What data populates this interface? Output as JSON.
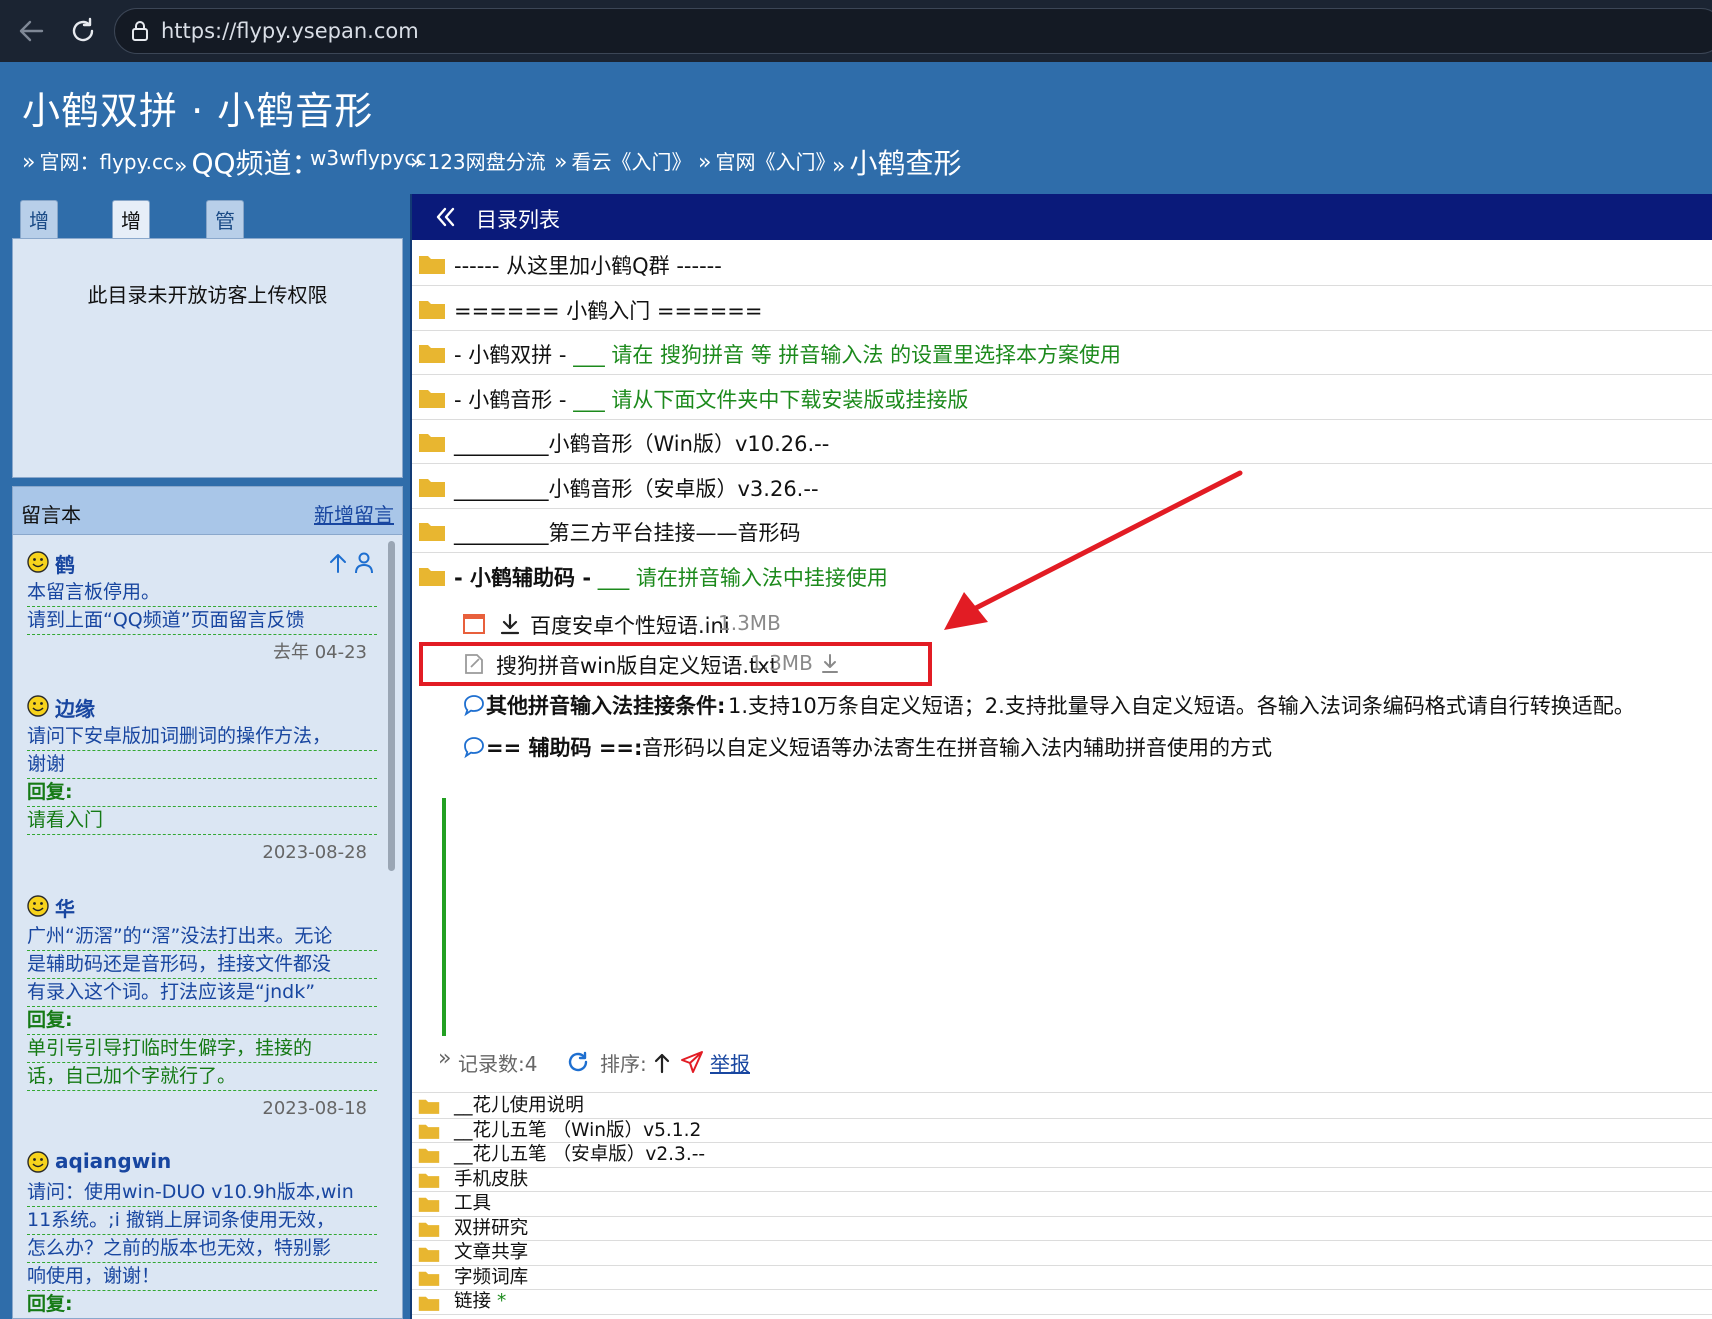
{
  "browser": {
    "url": "https://flypy.ysepan.com"
  },
  "header": {
    "title": "小鹤双拼 · 小鹤音形",
    "nav": [
      {
        "raq": "»",
        "text": "官网：flypy.cc"
      },
      {
        "raq": "»",
        "text": "QQ频道："
      },
      {
        "raq": "",
        "text": "w3wflypycc"
      },
      {
        "raq": "»",
        "text": "123网盘分流"
      },
      {
        "raq": "»",
        "text": "看云《入门》"
      },
      {
        "raq": "»",
        "text": "官网《入门》"
      },
      {
        "raq": "»",
        "text": "小鹤查形"
      }
    ]
  },
  "left": {
    "tabs": [
      "增加目录",
      "增加数据",
      "管理区"
    ],
    "upload_notice": "此目录未开放访客上传权限",
    "guestbook": {
      "title": "留言本",
      "new_label": "新增留言",
      "messages": [
        {
          "author": "鹤",
          "lines": [
            "本留言板停用。",
            "请到上面“QQ频道”页面留言反馈"
          ],
          "reply_label": "",
          "reply": [],
          "date": "去年 04-23"
        },
        {
          "author": "边缘",
          "lines": [
            "请问下安卓版加词删词的操作方法，",
            "谢谢"
          ],
          "reply_label": "回复:",
          "reply": [
            "请看入门"
          ],
          "date": "2023-08-28"
        },
        {
          "author": "华",
          "lines": [
            "广州“沥滘”的“滘”没法打出来。无论",
            "是辅助码还是音形码，挂接文件都没",
            "有录入这个词。打法应该是“jndk”"
          ],
          "reply_label": "回复:",
          "reply": [
            "单引号引导打临时生僻字，挂接的",
            "话，自己加个字就行了。"
          ],
          "date": "2023-08-18"
        },
        {
          "author": "aqiangwin",
          "lines": [
            "请问：使用win-DUO v10.9h版本,win",
            "11系统。;i 撤销上屏词条使用无效，",
            "怎么办？之前的版本也无效，特别影",
            "响使用，谢谢！"
          ],
          "reply_label": "回复:",
          "reply": [],
          "date": ""
        }
      ]
    }
  },
  "right": {
    "title": "目录列表",
    "folders_top": [
      {
        "text": "------ 从这里加小鹤Q群 ------",
        "green": ""
      },
      {
        "text": "====== 小鹤入门 ======",
        "green": ""
      },
      {
        "text": "- 小鹤双拼 -  ",
        "green": "___ 请在 搜狗拼音 等 拼音输入法 的设置里选择本方案使用"
      },
      {
        "text": "- 小鹤音形 -  ",
        "green": "___ 请从下面文件夹中下载安装版或挂接版"
      },
      {
        "text": "_________小鹤音形（Win版）v10.26.--",
        "green": ""
      },
      {
        "text": "_________小鹤音形（安卓版）v3.26.--",
        "green": ""
      },
      {
        "text": "_________第三方平台挂接——音形码",
        "green": ""
      }
    ],
    "open_folder": {
      "bold": "- 小鹤辅助码 -",
      "green": "  ___ 请在拼音输入法中挂接使用"
    },
    "files": [
      {
        "name": "百度安卓个性短语.ini",
        "size": "1.3MB"
      },
      {
        "name": "搜狗拼音win版自定义短语.txt",
        "size": "1.3MB"
      }
    ],
    "notes": [
      {
        "title": "其他拼音输入法挂接条件:",
        "text": "1.支持10万条自定义短语；2.支持批量导入自定义短语。各输入法词条编码格式请自行转换适配。"
      },
      {
        "title": "== 辅助码 ==:",
        "text": "音形码以自定义短语等办法寄生在拼音输入法内辅助拼音使用的方式"
      }
    ],
    "record_bar": {
      "raq": "»",
      "count": "记录数:4",
      "sort": "排序:",
      "report": "举报"
    },
    "folders_bottom": [
      {
        "text": "__花儿使用说明",
        "star": ""
      },
      {
        "text": "__花儿五笔 （Win版）v5.1.2",
        "star": ""
      },
      {
        "text": "__花儿五笔 （安卓版）v2.3.--",
        "star": ""
      },
      {
        "text": "手机皮肤",
        "star": ""
      },
      {
        "text": "工具",
        "star": ""
      },
      {
        "text": "双拼研究",
        "star": ""
      },
      {
        "text": "文章共享",
        "star": ""
      },
      {
        "text": "字频词库",
        "star": ""
      },
      {
        "text": "链接",
        "star": "*"
      }
    ]
  },
  "colors": {
    "accent_blue": "#2f6daa",
    "dir_header": "#0a1a7a",
    "green": "#1c8a1c",
    "annotation_red": "#e21c24",
    "folder": "#e8b630"
  },
  "icons": [
    "back-arrow-icon",
    "reload-icon",
    "lock-icon",
    "collapse-icon",
    "folder-icon",
    "download-icon",
    "edit-file-icon",
    "comment-icon",
    "refresh-icon",
    "sort-up-icon",
    "report-send-icon",
    "smile-icon",
    "up-arrow-icon",
    "user-icon"
  ]
}
